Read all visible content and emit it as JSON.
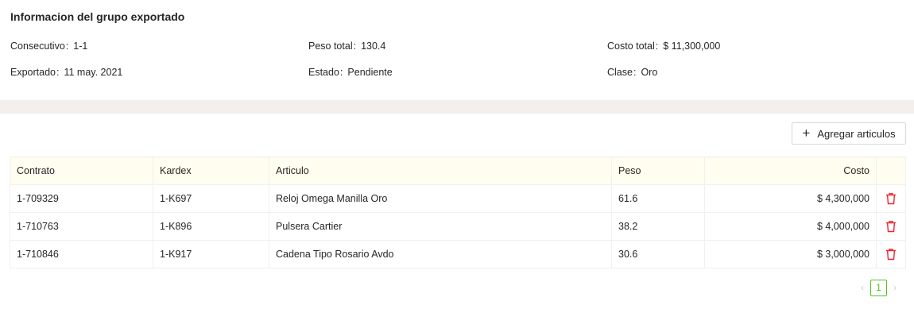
{
  "summary": {
    "title": "Informacion del grupo exportado",
    "consecutivo_label": "Consecutivo",
    "consecutivo_value": "1-1",
    "peso_label": "Peso total",
    "peso_value": "130.4",
    "costo_label": "Costo total",
    "costo_value": "$ 11,300,000",
    "exportado_label": "Exportado",
    "exportado_value": "11 may. 2021",
    "estado_label": "Estado",
    "estado_value": "Pendiente",
    "clase_label": "Clase",
    "clase_value": "Oro"
  },
  "toolbar": {
    "add_label": "Agregar articulos"
  },
  "table": {
    "columns": [
      "Contrato",
      "Kardex",
      "Articulo",
      "Peso",
      "Costo"
    ],
    "rows": [
      {
        "contrato": "1-709329",
        "kardex": "1-K697",
        "articulo": "Reloj Omega Manilla Oro",
        "peso": "61.6",
        "costo": "$ 4,300,000"
      },
      {
        "contrato": "1-710763",
        "kardex": "1-K896",
        "articulo": "Pulsera Cartier",
        "peso": "38.2",
        "costo": "$ 4,000,000"
      },
      {
        "contrato": "1-710846",
        "kardex": "1-K917",
        "articulo": "Cadena Tipo Rosario Avdo",
        "peso": "30.6",
        "costo": "$ 3,000,000"
      }
    ]
  },
  "pagination": {
    "current_page": "1"
  },
  "colors": {
    "header_bg": "#fffdf0",
    "delete_red": "#f5222d",
    "pager_green": "#52c41a",
    "page_bg": "#f2efec"
  }
}
